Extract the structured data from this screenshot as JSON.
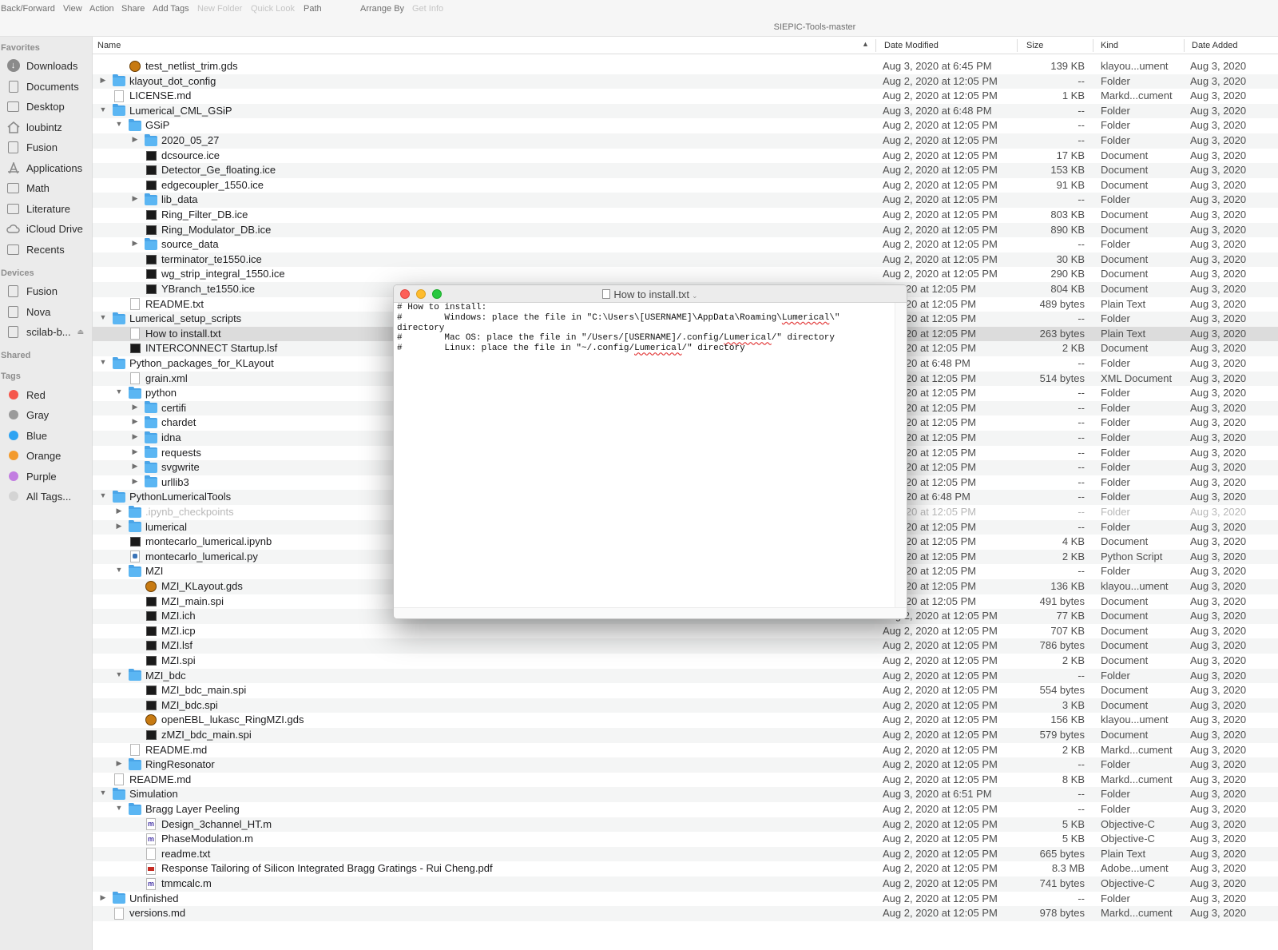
{
  "toolbar": {
    "items": [
      "Back/Forward",
      "View",
      "Action",
      "Share",
      "Add Tags",
      "New Folder",
      "Quick Look",
      "Path",
      "Arrange By",
      "Get Info"
    ]
  },
  "window": {
    "title": "SIEPIC-Tools-master"
  },
  "sidebar": {
    "favorites_label": "Favorites",
    "favorites": [
      "Downloads",
      "Documents",
      "Desktop",
      "loubintz",
      "Fusion",
      "Applications",
      "Math",
      "Literature",
      "iCloud Drive",
      "Recents"
    ],
    "devices_label": "Devices",
    "devices": [
      "Fusion",
      "Nova",
      "scilab-b..."
    ],
    "shared_label": "Shared",
    "tags_label": "Tags",
    "tags": [
      {
        "label": "Red",
        "color": "#f5574c"
      },
      {
        "label": "Gray",
        "color": "#9a9a9a"
      },
      {
        "label": "Blue",
        "color": "#2ea3f2"
      },
      {
        "label": "Orange",
        "color": "#f39a2c"
      },
      {
        "label": "Purple",
        "color": "#c27de1"
      },
      {
        "label": "All Tags...",
        "color": "#d4d4d4"
      }
    ]
  },
  "columns": {
    "name": "Name",
    "date_modified": "Date Modified",
    "size": "Size",
    "kind": "Kind",
    "date_added": "Date Added"
  },
  "rows": [
    {
      "name": "test_netlist_trim.gds",
      "modified": "Aug 3, 2020 at 6:45 PM",
      "size": "139 KB",
      "kind": "klayou...ument",
      "added": "Aug 3, 2020",
      "depth": 2,
      "icon": "klayout",
      "expand": ""
    },
    {
      "name": "klayout_dot_config",
      "modified": "Aug 2, 2020 at 12:05 PM",
      "size": "--",
      "kind": "Folder",
      "added": "Aug 3, 2020",
      "depth": 1,
      "icon": "folder",
      "expand": "closed"
    },
    {
      "name": "LICENSE.md",
      "modified": "Aug 2, 2020 at 12:05 PM",
      "size": "1 KB",
      "kind": "Markd...cument",
      "added": "Aug 3, 2020",
      "depth": 1,
      "icon": "doc",
      "expand": ""
    },
    {
      "name": "Lumerical_CML_GSiP",
      "modified": "Aug 3, 2020 at 6:48 PM",
      "size": "--",
      "kind": "Folder",
      "added": "Aug 3, 2020",
      "depth": 1,
      "icon": "folder",
      "expand": "open"
    },
    {
      "name": "GSiP",
      "modified": "Aug 2, 2020 at 12:05 PM",
      "size": "--",
      "kind": "Folder",
      "added": "Aug 3, 2020",
      "depth": 2,
      "icon": "folder",
      "expand": "open"
    },
    {
      "name": "2020_05_27",
      "modified": "Aug 2, 2020 at 12:05 PM",
      "size": "--",
      "kind": "Folder",
      "added": "Aug 3, 2020",
      "depth": 3,
      "icon": "folder",
      "expand": "closed"
    },
    {
      "name": "dcsource.ice",
      "modified": "Aug 2, 2020 at 12:05 PM",
      "size": "17 KB",
      "kind": "Document",
      "added": "Aug 3, 2020",
      "depth": 3,
      "icon": "term",
      "expand": ""
    },
    {
      "name": "Detector_Ge_floating.ice",
      "modified": "Aug 2, 2020 at 12:05 PM",
      "size": "153 KB",
      "kind": "Document",
      "added": "Aug 3, 2020",
      "depth": 3,
      "icon": "term",
      "expand": ""
    },
    {
      "name": "edgecoupler_1550.ice",
      "modified": "Aug 2, 2020 at 12:05 PM",
      "size": "91 KB",
      "kind": "Document",
      "added": "Aug 3, 2020",
      "depth": 3,
      "icon": "term",
      "expand": ""
    },
    {
      "name": "lib_data",
      "modified": "Aug 2, 2020 at 12:05 PM",
      "size": "--",
      "kind": "Folder",
      "added": "Aug 3, 2020",
      "depth": 3,
      "icon": "folder",
      "expand": "closed"
    },
    {
      "name": "Ring_Filter_DB.ice",
      "modified": "Aug 2, 2020 at 12:05 PM",
      "size": "803 KB",
      "kind": "Document",
      "added": "Aug 3, 2020",
      "depth": 3,
      "icon": "term",
      "expand": ""
    },
    {
      "name": "Ring_Modulator_DB.ice",
      "modified": "Aug 2, 2020 at 12:05 PM",
      "size": "890 KB",
      "kind": "Document",
      "added": "Aug 3, 2020",
      "depth": 3,
      "icon": "term",
      "expand": ""
    },
    {
      "name": "source_data",
      "modified": "Aug 2, 2020 at 12:05 PM",
      "size": "--",
      "kind": "Folder",
      "added": "Aug 3, 2020",
      "depth": 3,
      "icon": "folder",
      "expand": "closed"
    },
    {
      "name": "terminator_te1550.ice",
      "modified": "Aug 2, 2020 at 12:05 PM",
      "size": "30 KB",
      "kind": "Document",
      "added": "Aug 3, 2020",
      "depth": 3,
      "icon": "term",
      "expand": ""
    },
    {
      "name": "wg_strip_integral_1550.ice",
      "modified": "Aug 2, 2020 at 12:05 PM",
      "size": "290 KB",
      "kind": "Document",
      "added": "Aug 3, 2020",
      "depth": 3,
      "icon": "term",
      "expand": ""
    },
    {
      "name": "YBranch_te1550.ice",
      "modified": "2, 2020 at 12:05 PM",
      "size": "804 KB",
      "kind": "Document",
      "added": "Aug 3, 2020",
      "depth": 3,
      "icon": "term",
      "expand": ""
    },
    {
      "name": "README.txt",
      "modified": "2, 2020 at 12:05 PM",
      "size": "489 bytes",
      "kind": "Plain Text",
      "added": "Aug 3, 2020",
      "depth": 2,
      "icon": "doc",
      "expand": ""
    },
    {
      "name": "Lumerical_setup_scripts",
      "modified": "2, 2020 at 12:05 PM",
      "size": "--",
      "kind": "Folder",
      "added": "Aug 3, 2020",
      "depth": 1,
      "icon": "folder",
      "expand": "open"
    },
    {
      "name": "How to install.txt",
      "modified": "2, 2020 at 12:05 PM",
      "size": "263 bytes",
      "kind": "Plain Text",
      "added": "Aug 3, 2020",
      "depth": 2,
      "icon": "doc",
      "expand": "",
      "selected": true
    },
    {
      "name": "INTERCONNECT Startup.lsf",
      "modified": "2, 2020 at 12:05 PM",
      "size": "2 KB",
      "kind": "Document",
      "added": "Aug 3, 2020",
      "depth": 2,
      "icon": "term",
      "expand": ""
    },
    {
      "name": "Python_packages_for_KLayout",
      "modified": "3, 2020 at 6:48 PM",
      "size": "--",
      "kind": "Folder",
      "added": "Aug 3, 2020",
      "depth": 1,
      "icon": "folder",
      "expand": "open"
    },
    {
      "name": "grain.xml",
      "modified": "2, 2020 at 12:05 PM",
      "size": "514 bytes",
      "kind": "XML Document",
      "added": "Aug 3, 2020",
      "depth": 2,
      "icon": "doc",
      "expand": ""
    },
    {
      "name": "python",
      "modified": "2, 2020 at 12:05 PM",
      "size": "--",
      "kind": "Folder",
      "added": "Aug 3, 2020",
      "depth": 2,
      "icon": "folder",
      "expand": "open"
    },
    {
      "name": "certifi",
      "modified": "2, 2020 at 12:05 PM",
      "size": "--",
      "kind": "Folder",
      "added": "Aug 3, 2020",
      "depth": 3,
      "icon": "folder",
      "expand": "closed"
    },
    {
      "name": "chardet",
      "modified": "2, 2020 at 12:05 PM",
      "size": "--",
      "kind": "Folder",
      "added": "Aug 3, 2020",
      "depth": 3,
      "icon": "folder",
      "expand": "closed"
    },
    {
      "name": "idna",
      "modified": "2, 2020 at 12:05 PM",
      "size": "--",
      "kind": "Folder",
      "added": "Aug 3, 2020",
      "depth": 3,
      "icon": "folder",
      "expand": "closed"
    },
    {
      "name": "requests",
      "modified": "2, 2020 at 12:05 PM",
      "size": "--",
      "kind": "Folder",
      "added": "Aug 3, 2020",
      "depth": 3,
      "icon": "folder",
      "expand": "closed"
    },
    {
      "name": "svgwrite",
      "modified": "2, 2020 at 12:05 PM",
      "size": "--",
      "kind": "Folder",
      "added": "Aug 3, 2020",
      "depth": 3,
      "icon": "folder",
      "expand": "closed"
    },
    {
      "name": "urllib3",
      "modified": "2, 2020 at 12:05 PM",
      "size": "--",
      "kind": "Folder",
      "added": "Aug 3, 2020",
      "depth": 3,
      "icon": "folder",
      "expand": "closed"
    },
    {
      "name": "PythonLumericalTools",
      "modified": "3, 2020 at 6:48 PM",
      "size": "--",
      "kind": "Folder",
      "added": "Aug 3, 2020",
      "depth": 1,
      "icon": "folder",
      "expand": "open"
    },
    {
      "name": ".ipynb_checkpoints",
      "modified": "2, 2020 at 12:05 PM",
      "size": "--",
      "kind": "Folder",
      "added": "Aug 3, 2020",
      "depth": 2,
      "icon": "folder",
      "expand": "closed",
      "dim": true
    },
    {
      "name": "lumerical",
      "modified": "2, 2020 at 12:05 PM",
      "size": "--",
      "kind": "Folder",
      "added": "Aug 3, 2020",
      "depth": 2,
      "icon": "folder",
      "expand": "closed"
    },
    {
      "name": "montecarlo_lumerical.ipynb",
      "modified": "2, 2020 at 12:05 PM",
      "size": "4 KB",
      "kind": "Document",
      "added": "Aug 3, 2020",
      "depth": 2,
      "icon": "term",
      "expand": ""
    },
    {
      "name": "montecarlo_lumerical.py",
      "modified": "2, 2020 at 12:05 PM",
      "size": "2 KB",
      "kind": "Python Script",
      "added": "Aug 3, 2020",
      "depth": 2,
      "icon": "py",
      "expand": ""
    },
    {
      "name": "MZI",
      "modified": "2, 2020 at 12:05 PM",
      "size": "--",
      "kind": "Folder",
      "added": "Aug 3, 2020",
      "depth": 2,
      "icon": "folder",
      "expand": "open"
    },
    {
      "name": "MZI_KLayout.gds",
      "modified": "2, 2020 at 12:05 PM",
      "size": "136 KB",
      "kind": "klayou...ument",
      "added": "Aug 3, 2020",
      "depth": 3,
      "icon": "klayout",
      "expand": ""
    },
    {
      "name": "MZI_main.spi",
      "modified": "2, 2020 at 12:05 PM",
      "size": "491 bytes",
      "kind": "Document",
      "added": "Aug 3, 2020",
      "depth": 3,
      "icon": "term",
      "expand": ""
    },
    {
      "name": "MZI.ich",
      "modified": "Aug 2, 2020 at 12:05 PM",
      "size": "77 KB",
      "kind": "Document",
      "added": "Aug 3, 2020",
      "depth": 3,
      "icon": "term",
      "expand": ""
    },
    {
      "name": "MZI.icp",
      "modified": "Aug 2, 2020 at 12:05 PM",
      "size": "707 KB",
      "kind": "Document",
      "added": "Aug 3, 2020",
      "depth": 3,
      "icon": "term",
      "expand": ""
    },
    {
      "name": "MZI.lsf",
      "modified": "Aug 2, 2020 at 12:05 PM",
      "size": "786 bytes",
      "kind": "Document",
      "added": "Aug 3, 2020",
      "depth": 3,
      "icon": "term",
      "expand": ""
    },
    {
      "name": "MZI.spi",
      "modified": "Aug 2, 2020 at 12:05 PM",
      "size": "2 KB",
      "kind": "Document",
      "added": "Aug 3, 2020",
      "depth": 3,
      "icon": "term",
      "expand": ""
    },
    {
      "name": "MZI_bdc",
      "modified": "Aug 2, 2020 at 12:05 PM",
      "size": "--",
      "kind": "Folder",
      "added": "Aug 3, 2020",
      "depth": 2,
      "icon": "folder",
      "expand": "open"
    },
    {
      "name": "MZI_bdc_main.spi",
      "modified": "Aug 2, 2020 at 12:05 PM",
      "size": "554 bytes",
      "kind": "Document",
      "added": "Aug 3, 2020",
      "depth": 3,
      "icon": "term",
      "expand": ""
    },
    {
      "name": "MZI_bdc.spi",
      "modified": "Aug 2, 2020 at 12:05 PM",
      "size": "3 KB",
      "kind": "Document",
      "added": "Aug 3, 2020",
      "depth": 3,
      "icon": "term",
      "expand": ""
    },
    {
      "name": "openEBL_lukasc_RingMZI.gds",
      "modified": "Aug 2, 2020 at 12:05 PM",
      "size": "156 KB",
      "kind": "klayou...ument",
      "added": "Aug 3, 2020",
      "depth": 3,
      "icon": "klayout",
      "expand": ""
    },
    {
      "name": "zMZI_bdc_main.spi",
      "modified": "Aug 2, 2020 at 12:05 PM",
      "size": "579 bytes",
      "kind": "Document",
      "added": "Aug 3, 2020",
      "depth": 3,
      "icon": "term",
      "expand": ""
    },
    {
      "name": "README.md",
      "modified": "Aug 2, 2020 at 12:05 PM",
      "size": "2 KB",
      "kind": "Markd...cument",
      "added": "Aug 3, 2020",
      "depth": 2,
      "icon": "doc",
      "expand": ""
    },
    {
      "name": "RingResonator",
      "modified": "Aug 2, 2020 at 12:05 PM",
      "size": "--",
      "kind": "Folder",
      "added": "Aug 3, 2020",
      "depth": 2,
      "icon": "folder",
      "expand": "closed"
    },
    {
      "name": "README.md",
      "modified": "Aug 2, 2020 at 12:05 PM",
      "size": "8 KB",
      "kind": "Markd...cument",
      "added": "Aug 3, 2020",
      "depth": 1,
      "icon": "doc",
      "expand": ""
    },
    {
      "name": "Simulation",
      "modified": "Aug 3, 2020 at 6:51 PM",
      "size": "--",
      "kind": "Folder",
      "added": "Aug 3, 2020",
      "depth": 1,
      "icon": "folder",
      "expand": "open"
    },
    {
      "name": "Bragg Layer Peeling",
      "modified": "Aug 2, 2020 at 12:05 PM",
      "size": "--",
      "kind": "Folder",
      "added": "Aug 3, 2020",
      "depth": 2,
      "icon": "folder",
      "expand": "open"
    },
    {
      "name": "Design_3channel_HT.m",
      "modified": "Aug 2, 2020 at 12:05 PM",
      "size": "5 KB",
      "kind": "Objective-C",
      "added": "Aug 3, 2020",
      "depth": 3,
      "icon": "m",
      "expand": ""
    },
    {
      "name": "PhaseModulation.m",
      "modified": "Aug 2, 2020 at 12:05 PM",
      "size": "5 KB",
      "kind": "Objective-C",
      "added": "Aug 3, 2020",
      "depth": 3,
      "icon": "m",
      "expand": ""
    },
    {
      "name": "readme.txt",
      "modified": "Aug 2, 2020 at 12:05 PM",
      "size": "665 bytes",
      "kind": "Plain Text",
      "added": "Aug 3, 2020",
      "depth": 3,
      "icon": "doc",
      "expand": ""
    },
    {
      "name": "Response Tailoring of Silicon Integrated Bragg Gratings - Rui Cheng.pdf",
      "modified": "Aug 2, 2020 at 12:05 PM",
      "size": "8.3 MB",
      "kind": "Adobe...ument",
      "added": "Aug 3, 2020",
      "depth": 3,
      "icon": "pdf",
      "expand": ""
    },
    {
      "name": "tmmcalc.m",
      "modified": "Aug 2, 2020 at 12:05 PM",
      "size": "741 bytes",
      "kind": "Objective-C",
      "added": "Aug 3, 2020",
      "depth": 3,
      "icon": "m",
      "expand": ""
    },
    {
      "name": "Unfinished",
      "modified": "Aug 2, 2020 at 12:05 PM",
      "size": "--",
      "kind": "Folder",
      "added": "Aug 3, 2020",
      "depth": 1,
      "icon": "folder",
      "expand": "closed"
    },
    {
      "name": "versions.md",
      "modified": "Aug 2, 2020 at 12:05 PM",
      "size": "978 bytes",
      "kind": "Markd...cument",
      "added": "Aug 3, 2020",
      "depth": 1,
      "icon": "doc",
      "expand": ""
    }
  ],
  "textedit": {
    "title": "How to install.txt",
    "lines": [
      "# How to install:",
      "#        Windows: place the file in \"C:\\Users\\[USERNAME]\\AppData\\Roaming\\Lumerical\\\"",
      "directory",
      "#        Mac OS: place the file in \"/Users/[USERNAME]/.config/Lumerical/\" directory",
      "#        Linux: place the file in \"~/.config/Lumerical/\" directory"
    ]
  }
}
